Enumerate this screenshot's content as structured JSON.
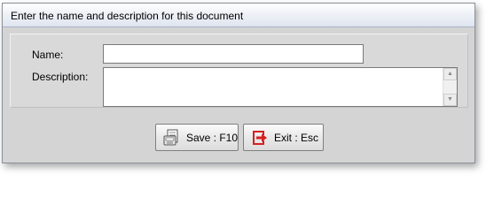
{
  "dialog": {
    "title": "Enter the name and description for this document"
  },
  "form": {
    "name_label": "Name:",
    "name_value": "",
    "description_label": "Description:",
    "description_value": ""
  },
  "buttons": {
    "save_label": "Save : F10",
    "exit_label": "Exit : Esc"
  },
  "icons": {
    "save": "save-document-icon",
    "exit": "exit-icon",
    "scroll_up": "scroll-up-arrow-icon",
    "scroll_down": "scroll-down-arrow-icon"
  },
  "colors": {
    "dialog_background": "#d4d4d4",
    "exit_icon": "#d61f1f"
  }
}
